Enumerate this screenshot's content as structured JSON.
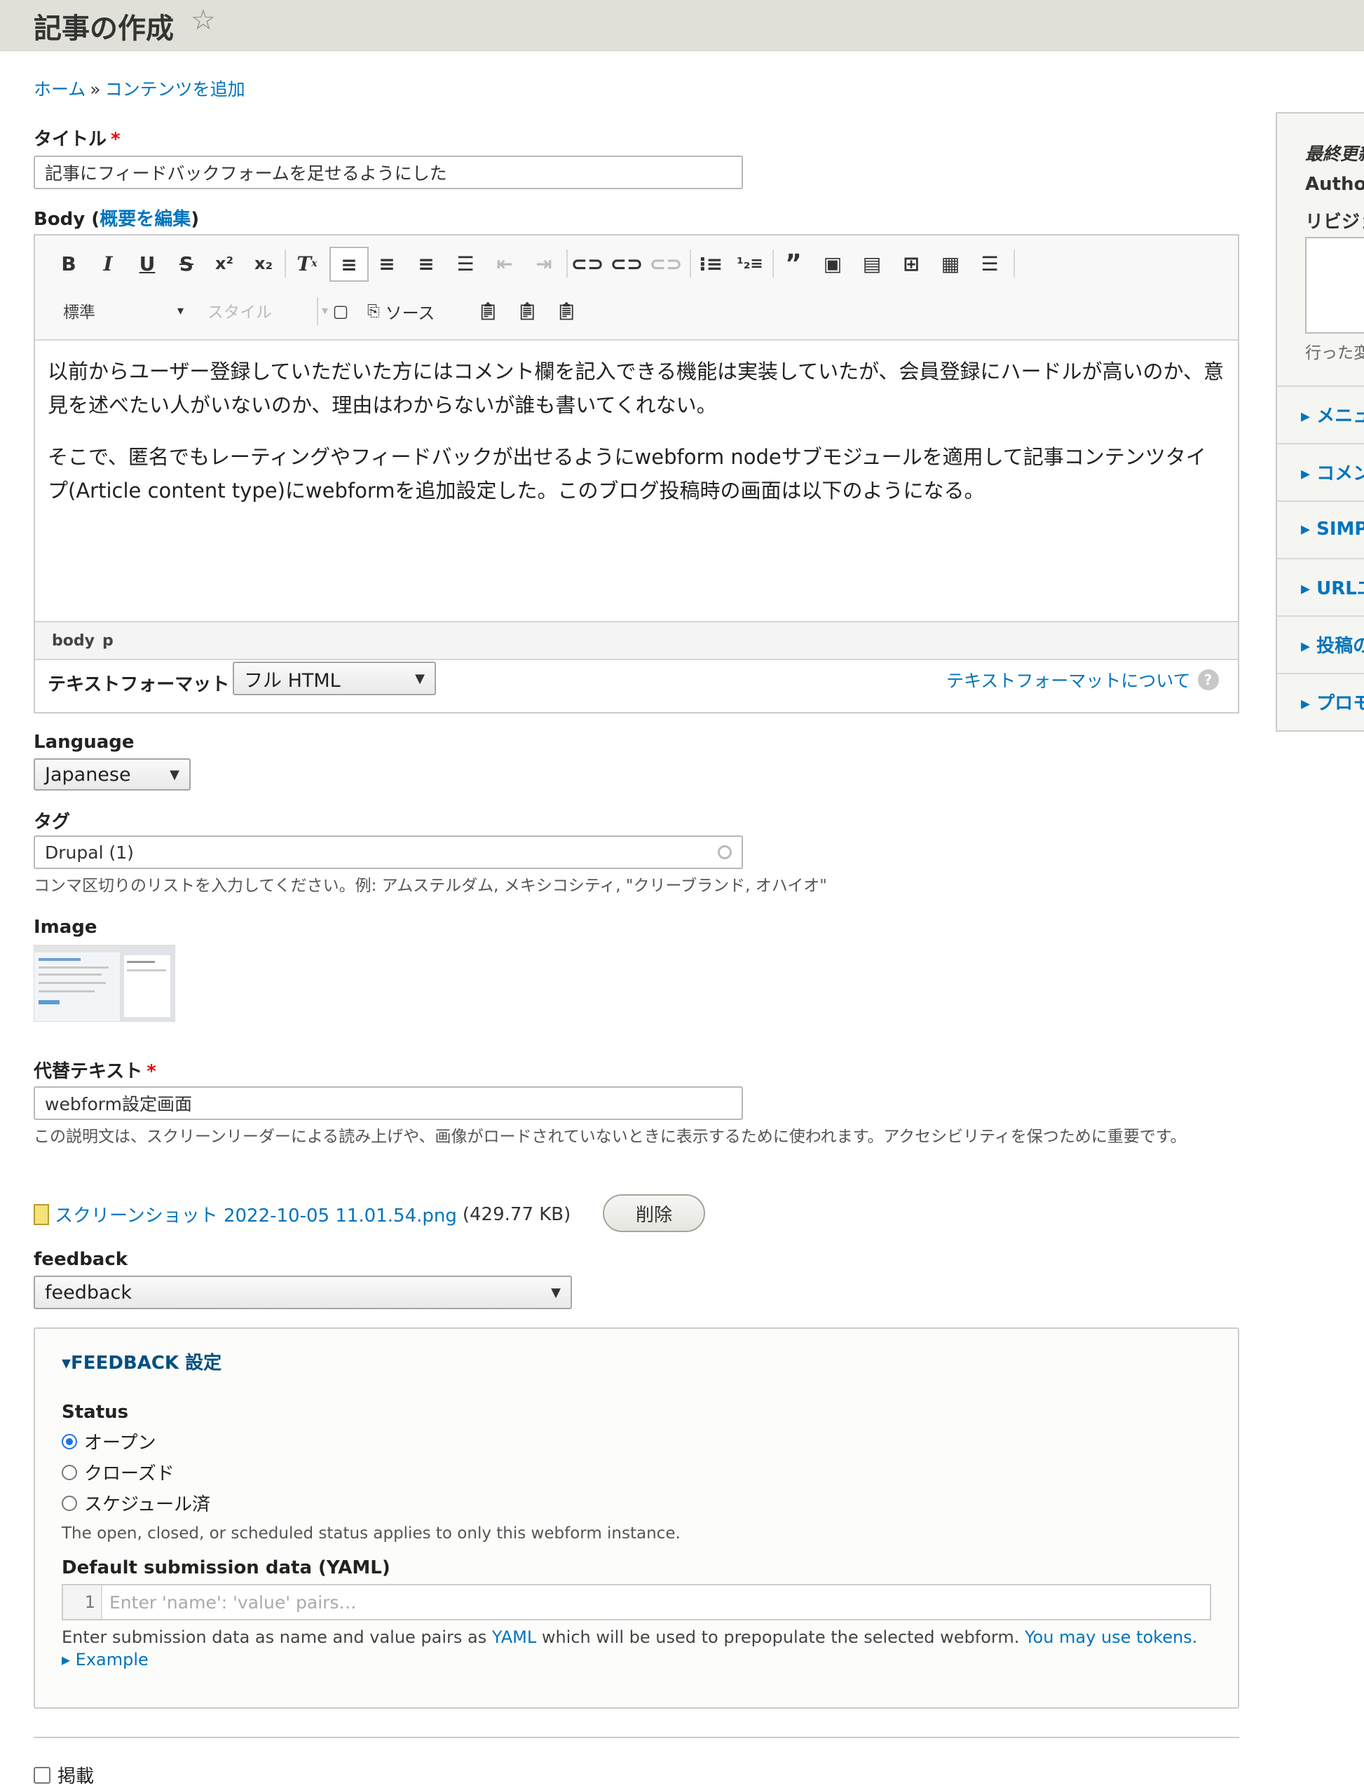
{
  "page": {
    "title": "記事の作成",
    "star_icon": "star-outline-icon"
  },
  "breadcrumb": {
    "home": "ホーム",
    "separator": "»",
    "add_content": "コンテンツを追加"
  },
  "title_field": {
    "label": "タイトル",
    "required_mark": "*",
    "value": "記事にフィードバックフォームを足せるようにした"
  },
  "body_field": {
    "label_prefix": "Body (",
    "edit_summary": "概要を編集",
    "label_suffix": ")",
    "toolbar": {
      "buttons": [
        "bold",
        "italic",
        "underline",
        "strikethrough",
        "superscript",
        "subscript",
        "remove-format",
        "align-left",
        "align-center",
        "align-right",
        "justify",
        "outdent",
        "indent",
        "link",
        "unlink",
        "anchor",
        "bulleted-list",
        "numbered-list",
        "blockquote",
        "image",
        "media",
        "image-upload",
        "table",
        "horizontal-line"
      ],
      "format_select": "標準",
      "style_select": "スタイル",
      "source_label": "ソース"
    },
    "paragraphs": [
      "以前からユーザー登録していただいた方にはコメント欄を記入できる機能は実装していたが、会員登録にハードルが高いのか、意見を述べたい人がいないのか、理由はわからないが誰も書いてくれない。",
      "そこで、匿名でもレーティングやフィードバックが出せるようにwebform nodeサブモジュールを適用して記事コンテンツタイプ(Article content type)にwebformを追加設定した。このブログ投稿時の画面は以下のようになる。"
    ],
    "path": [
      "body",
      "p"
    ],
    "text_format_label": "テキストフォーマット",
    "text_format_value": "フル HTML",
    "text_format_help": "テキストフォーマットについて"
  },
  "language": {
    "label": "Language",
    "value": "Japanese"
  },
  "tags": {
    "label": "タグ",
    "value": "Drupal (1)",
    "description": "コンマ区切りのリストを入力してください。例: アムステルダム, メキシコシティ, \"クリーブランド, オハイオ\""
  },
  "image": {
    "label": "Image",
    "alt_label": "代替テキスト",
    "alt_required": "*",
    "alt_value": "webform設定画面",
    "alt_description": "この説明文は、スクリーンリーダーによる読み上げや、画像がロードされていないときに表示するために使われます。アクセシビリティを保つために重要です。",
    "file_name": "スクリーンショット 2022-10-05 11.01.54.png",
    "file_size": "(429.77 KB)",
    "remove_button": "削除"
  },
  "feedback": {
    "label": "feedback",
    "value": "feedback"
  },
  "feedback_settings": {
    "summary": "▾FEEDBACK 設定",
    "status_label": "Status",
    "options": [
      {
        "label": "オープン",
        "selected": true
      },
      {
        "label": "クローズド",
        "selected": false
      },
      {
        "label": "スケジュール済",
        "selected": false
      }
    ],
    "status_description": "The open, closed, or scheduled status applies to only this webform instance.",
    "default_data_label": "Default submission data (YAML)",
    "line_number": "1",
    "placeholder": "Enter 'name': 'value' pairs…",
    "help_prefix": "Enter submission data as name and value pairs as",
    "yaml_link": "YAML",
    "help_middle": "which will be used to prepopulate the selected webform.",
    "tokens_link": "You may use tokens.",
    "example_toggle": "▸ Example"
  },
  "publish": {
    "label": "掲載"
  },
  "sidebar": {
    "last_saved": "最終更新",
    "author": "Author",
    "revision": "リビジョ",
    "revision_note": "行った変",
    "items": [
      "▸ メニュ",
      "▸ コメン",
      "▸ SIMPL",
      "▸ URLエ",
      "▸ 投稿の",
      "▸ プロモ"
    ]
  },
  "colors": {
    "link": "#0074bd",
    "required": "#ee0000",
    "header_bg": "#e0e0d8",
    "radio_selected": "#1a73e8"
  }
}
